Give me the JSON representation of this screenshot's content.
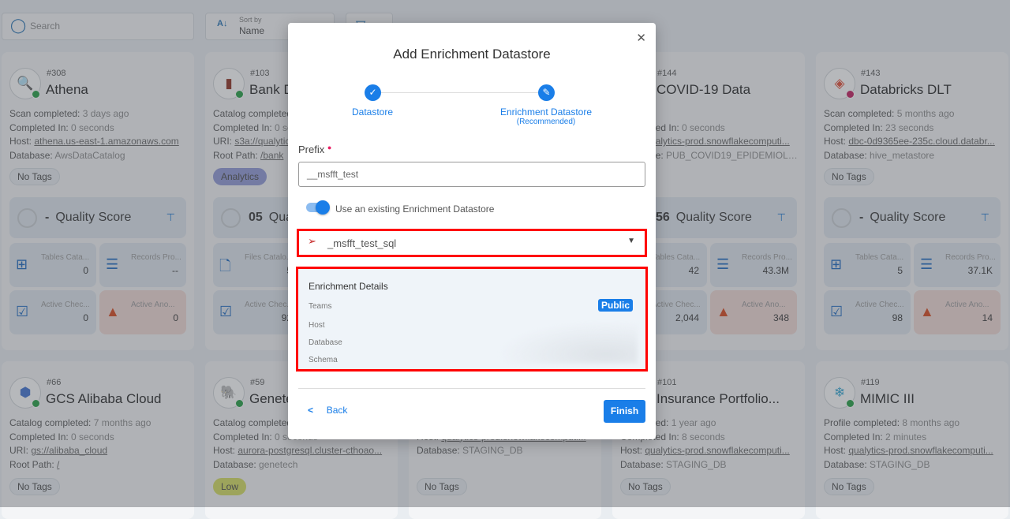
{
  "toolbar": {
    "search_placeholder": "Search",
    "sort_label": "Sort by",
    "sort_value": "Name"
  },
  "cards": [
    {
      "id": "#308",
      "name": "Athena",
      "icon": "athena-icon",
      "status": "#1e9e3e",
      "lines": [
        [
          "Scan completed: ",
          "3 days ago",
          0
        ],
        [
          "Completed In: ",
          "0 seconds",
          0
        ],
        [
          "Host: ",
          "athena.us-east-1.amazonaws.com",
          1
        ],
        [
          "Database: ",
          "AwsDataCatalog",
          0
        ]
      ],
      "tag": "No Tags",
      "quality": "-",
      "quality_label": "Quality Score",
      "metrics": [
        [
          "table-icon",
          "Tables Cata...",
          "0"
        ],
        [
          "records-icon",
          "Records Pro...",
          "--"
        ],
        [
          "check-icon",
          "Active Chec...",
          "0"
        ],
        [
          "warning-icon",
          "Active Ano...",
          "0"
        ]
      ]
    },
    {
      "id": "#103",
      "name": "Bank Dataset",
      "icon": "s3-icon",
      "status": "#1e9e3e",
      "lines": [
        [
          "Catalog completed: ",
          ""
        ],
        [
          "Completed In: ",
          "0 seconds",
          0
        ],
        [
          "URI: ",
          "s3a://qualytics",
          1
        ],
        [
          "Root Path: ",
          "/bank",
          1
        ]
      ],
      "tag": "Analytics",
      "quality": "05",
      "quality_label": "Quality Score",
      "metrics": [
        [
          "file-icon",
          "Files Catalo...",
          "5"
        ],
        [
          "records-icon",
          "Records Pro...",
          ""
        ],
        [
          "check-icon",
          "Active Chec...",
          "92"
        ],
        [
          "warning-icon",
          "Active Ano...",
          ""
        ]
      ]
    },
    {
      "id": "",
      "name": "",
      "icon": "",
      "status": "",
      "lines": [],
      "tag": "",
      "quality": "",
      "quality_label": "",
      "metrics": []
    },
    {
      "id": "#144",
      "name": "COVID-19 Data",
      "icon": "snowflake-icon",
      "status": "#1e9e3e",
      "lines": [
        [
          "",
          "ago",
          0
        ],
        [
          "Completed In: ",
          "0 seconds",
          0
        ],
        [
          "Host: ",
          "qualytics-prod.snowflakecomputi...",
          1
        ],
        [
          "Database: ",
          "PUB_COVID19_EPIDEMIOLO...",
          0
        ]
      ],
      "tag": "",
      "quality": "56",
      "quality_label": "Quality Score",
      "metrics": [
        [
          "table-icon",
          "Tables Cata...",
          "42"
        ],
        [
          "records-icon",
          "Records Pro...",
          "43.3M"
        ],
        [
          "check-icon",
          "Active Chec...",
          "2,044"
        ],
        [
          "warning-icon",
          "Active Ano...",
          "348"
        ]
      ]
    },
    {
      "id": "#143",
      "name": "Databricks DLT",
      "icon": "databricks-icon",
      "status": "#c2185b",
      "lines": [
        [
          "Scan completed: ",
          "5 months ago",
          0
        ],
        [
          "Completed In: ",
          "23 seconds",
          0
        ],
        [
          "Host: ",
          "dbc-0d9365ee-235c.cloud.databr...",
          1
        ],
        [
          "Database: ",
          "hive_metastore",
          0
        ]
      ],
      "tag": "No Tags",
      "quality": "-",
      "quality_label": "Quality Score",
      "metrics": [
        [
          "table-icon",
          "Tables Cata...",
          "5"
        ],
        [
          "records-icon",
          "Records Pro...",
          "37.1K"
        ],
        [
          "check-icon",
          "Active Chec...",
          "98"
        ],
        [
          "warning-icon",
          "Active Ano...",
          "14"
        ]
      ]
    },
    {
      "id": "#66",
      "name": "GCS Alibaba Cloud",
      "icon": "gcs-icon",
      "status": "#1e9e3e",
      "lines": [
        [
          "Catalog completed: ",
          "7 months ago",
          0
        ],
        [
          "Completed In: ",
          "0 seconds",
          0
        ],
        [
          "URI: ",
          "gs://alibaba_cloud",
          1
        ],
        [
          "Root Path: ",
          "/",
          1
        ]
      ],
      "tag": "No Tags"
    },
    {
      "id": "#59",
      "name": "Genetech",
      "icon": "postgres-icon",
      "status": "#1e9e3e",
      "lines": [
        [
          "Catalog completed: ",
          ""
        ],
        [
          "Completed In: ",
          "0 seconds",
          0
        ],
        [
          "Host: ",
          "aurora-postgresql.cluster-cthoao...",
          1
        ],
        [
          "Database: ",
          "genetech",
          0
        ]
      ],
      "tag": "Low",
      "tag_color": "#d4dc5c"
    },
    {
      "id": "",
      "name": "",
      "icon": "",
      "status": "",
      "lines": [
        [
          "",
          ""
        ],
        [
          "Completed In: ",
          "23 seconds",
          0
        ],
        [
          "Host: ",
          "qualytics-prod.snowflakecomputi...",
          1
        ],
        [
          "Database: ",
          "STAGING_DB",
          0
        ]
      ],
      "tag": "No Tags"
    },
    {
      "id": "#101",
      "name": "Insurance Portfolio...",
      "icon": "snowflake-icon",
      "status": "#1e9e3e",
      "lines": [
        [
          "Completed: ",
          "1 year ago",
          0
        ],
        [
          "Completed In: ",
          "8 seconds",
          0
        ],
        [
          "Host: ",
          "qualytics-prod.snowflakecomputi...",
          1
        ],
        [
          "Database: ",
          "STAGING_DB",
          0
        ]
      ],
      "tag": "No Tags"
    },
    {
      "id": "#119",
      "name": "MIMIC III",
      "icon": "snowflake-icon",
      "status": "#1e9e3e",
      "lines": [
        [
          "Profile completed: ",
          "8 months ago",
          0
        ],
        [
          "Completed In: ",
          "2 minutes",
          0
        ],
        [
          "Host: ",
          "qualytics-prod.snowflakecomputi...",
          1
        ],
        [
          "Database: ",
          "STAGING_DB",
          0
        ]
      ],
      "tag": "No Tags"
    }
  ],
  "modal": {
    "title": "Add Enrichment Datastore",
    "steps": [
      {
        "label": "Datastore"
      },
      {
        "label": "Enrichment Datastore",
        "sub": "(Recommended)"
      }
    ],
    "prefix_label": "Prefix",
    "prefix_value": "__msfft_test",
    "toggle_label": "Use an existing Enrichment Datastore",
    "toggle_on": true,
    "selected_datastore": "_msfft_test_sql",
    "details": {
      "title": "Enrichment Details",
      "teams_label": "Teams",
      "teams_value": "Public",
      "host_label": "Host",
      "database_label": "Database",
      "schema_label": "Schema"
    },
    "back_label": "Back",
    "finish_label": "Finish"
  },
  "colors": {
    "accent": "#1a7ee8",
    "highlight": "#ff0000"
  }
}
